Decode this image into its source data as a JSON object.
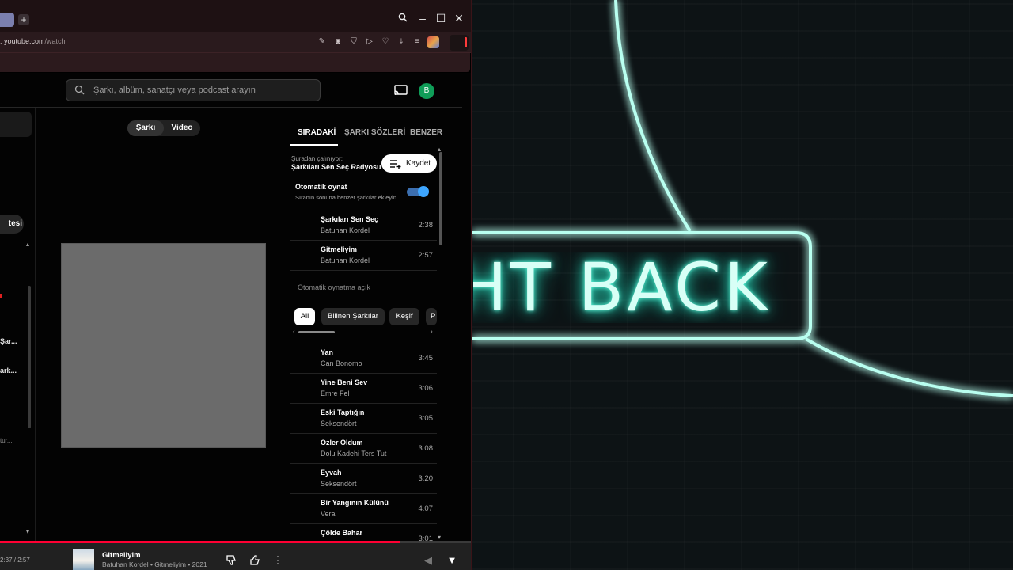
{
  "browser": {
    "url_prefix": "",
    "url_domain": ": youtube.com",
    "url_path": "/watch",
    "new_tab_icon": "plus-icon",
    "window_controls": [
      "search-icon",
      "minimize-icon",
      "maximize-icon",
      "close-icon"
    ]
  },
  "wallpaper": {
    "neon_text": "HT BACK",
    "neon_color": "#5fffe0"
  },
  "header": {
    "search_placeholder": "Şarkı, albüm, sanatçı veya podcast arayın",
    "avatar_letter": "B"
  },
  "left_panel": {
    "chip_label": "tesi",
    "items": [
      {
        "text": "Şar..."
      },
      {
        "text": "ark..."
      }
    ],
    "dim_text": "tur..."
  },
  "center": {
    "toggle": [
      "Şarkı",
      "Video"
    ],
    "active": "Şarkı"
  },
  "queue_panel": {
    "tabs": [
      "SIRADAKİ",
      "ŞARKI SÖZLERİ",
      "BENZER"
    ],
    "playing_from_label": "Şuradan çalınıyor:",
    "playlist_name": "Şarkıları Sen Seç Radyosu",
    "save_label": "Kaydet",
    "autoplay_title": "Otomatik oynat",
    "autoplay_subtitle": "Sıranın sonuna benzer şarkılar ekleyin.",
    "autoplay_enabled": true,
    "queue": [
      {
        "title": "Şarkıları Sen Seç",
        "artist": "Batuhan Kordel",
        "duration": "2:38"
      },
      {
        "title": "Gitmeliyim",
        "artist": "Batuhan Kordel",
        "duration": "2:57"
      }
    ],
    "autoplay_on_label": "Otomatik oynatma açık",
    "chips": [
      "All",
      "Bilinen Şarkılar",
      "Keşif",
      "P"
    ],
    "active_chip": "All",
    "autoplay_queue": [
      {
        "title": "Yan",
        "artist": "Can Bonomo",
        "duration": "3:45"
      },
      {
        "title": "Yine Beni Sev",
        "artist": "Emre Fel",
        "duration": "3:06"
      },
      {
        "title": "Eski Taptığın",
        "artist": "Seksendört",
        "duration": "3:05"
      },
      {
        "title": "Özler Oldum",
        "artist": "Dolu Kadehi Ters Tut",
        "duration": "3:08"
      },
      {
        "title": "Eyvah",
        "artist": "Seksendört",
        "duration": "3:20"
      },
      {
        "title": "Bir Yangının Külünü",
        "artist": "Vera",
        "duration": "4:07"
      },
      {
        "title": "Çölde Bahar",
        "artist": "",
        "duration": "3:01"
      }
    ]
  },
  "player": {
    "time": "2:37 / 2:57",
    "progress": 0.85,
    "progress_color": "#ff0033",
    "title": "Gitmeliyim",
    "subtitle": "Batuhan Kordel • Gitmeliyim • 2021"
  }
}
